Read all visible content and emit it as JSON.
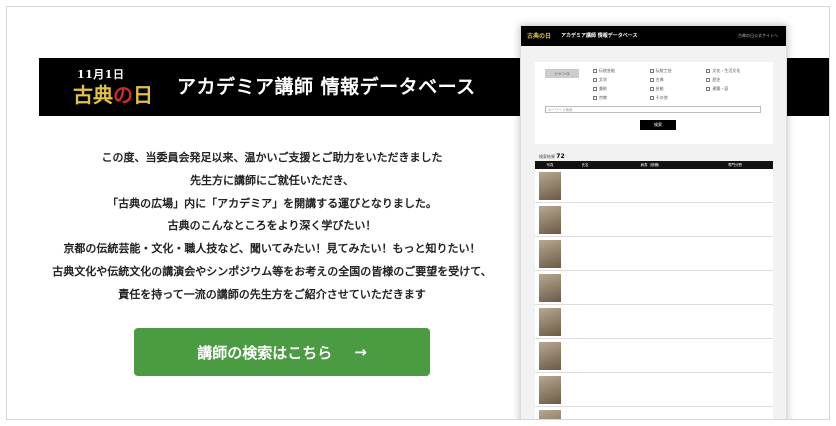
{
  "banner": {
    "logo_date": "11月1日",
    "logo_text_a": "古典",
    "logo_text_no": "の",
    "logo_text_b": "日",
    "title": "アカデミア講師 情報データベース"
  },
  "intro": {
    "lines": [
      "この度、当委員会発足以来、温かいご支援とご助力をいただきました",
      "先生方に講師にご就任いただき、",
      "「古典の広場」内に「アカデミア」を開講する運びとなりました。",
      "古典のこんなところをより深く学びたい！",
      "京都の伝統芸能・文化・職人技など、聞いてみたい！見てみたい！もっと知りたい！",
      "古典文化や伝統文化の講演会やシンポジウム等をお考えの全国の皆様のご要望を受けて、",
      "責任を持って一流の講師の先生方をご紹介させていただきます"
    ]
  },
  "cta": {
    "label": "講師の検索はこちら",
    "arrow": "→"
  },
  "mock": {
    "logo": "古典の日",
    "title": "アカデミア講師 情報データベース",
    "link": "古典の日公式サイトへ",
    "genre_label": "ジャンル",
    "checks": [
      "伝統芸能",
      "伝統工芸",
      "文化・生活文化",
      "文学",
      "古典",
      "歴史",
      "美術",
      "芸能",
      "建築・庭",
      "宗教",
      "その他",
      ""
    ],
    "keyword_placeholder": "キーワード検索",
    "search_btn": "検索",
    "count_label": "検索結果",
    "count": "72",
    "columns": [
      "写真",
      "氏名",
      "肩書（役職）",
      "専門分野"
    ],
    "rows": [
      {
        "name": "",
        "title": "",
        "field": ""
      },
      {
        "name": "",
        "title": "",
        "field": ""
      },
      {
        "name": "",
        "title": "",
        "field": ""
      },
      {
        "name": "",
        "title": "",
        "field": ""
      },
      {
        "name": "",
        "title": "",
        "field": ""
      },
      {
        "name": "",
        "title": "",
        "field": ""
      },
      {
        "name": "",
        "title": "",
        "field": ""
      },
      {
        "name": "",
        "title": "",
        "field": ""
      }
    ]
  },
  "colors": {
    "banner_bg": "#000000",
    "logo_gold": "#e0c24a",
    "logo_red": "#d02a2a",
    "cta_green": "#4a9b42"
  }
}
